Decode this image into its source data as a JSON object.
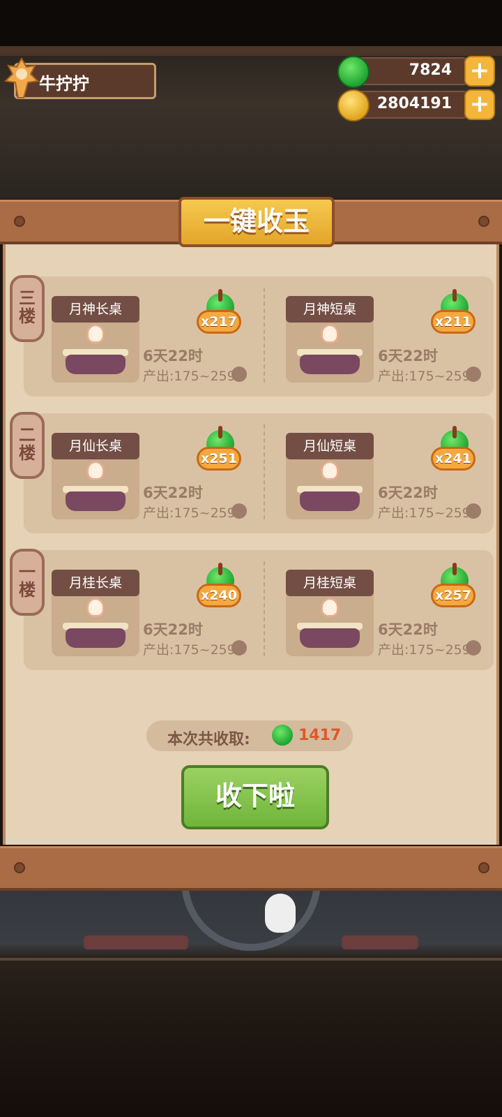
{
  "player": {
    "name": "牛拧拧"
  },
  "resources": [
    {
      "icon": "jade-icon",
      "value": "7824"
    },
    {
      "icon": "coin-icon",
      "value": "2804191"
    }
  ],
  "dialog": {
    "title": "一键收玉",
    "floors": [
      {
        "label": "三楼",
        "items": [
          {
            "name": "月神长桌",
            "count": "x217",
            "time": "6天22时",
            "output": "产出:175~259"
          },
          {
            "name": "月神短桌",
            "count": "x211",
            "time": "6天22时",
            "output": "产出:175~259"
          }
        ]
      },
      {
        "label": "二楼",
        "items": [
          {
            "name": "月仙长桌",
            "count": "x251",
            "time": "6天22时",
            "output": "产出:175~259"
          },
          {
            "name": "月仙短桌",
            "count": "x241",
            "time": "6天22时",
            "output": "产出:175~259"
          }
        ]
      },
      {
        "label": "一楼",
        "items": [
          {
            "name": "月桂长桌",
            "count": "x240",
            "time": "6天22时",
            "output": "产出:175~259"
          },
          {
            "name": "月桂短桌",
            "count": "x257",
            "time": "6天22时",
            "output": "产出:175~259"
          }
        ]
      }
    ],
    "total_label": "本次共收取:",
    "total_value": "1417",
    "collect_button": "收下啦"
  },
  "colors": {
    "jade": "#1fa432",
    "badge": "#f4a93e",
    "button": "#6fb53a",
    "total": "#e0572b"
  }
}
